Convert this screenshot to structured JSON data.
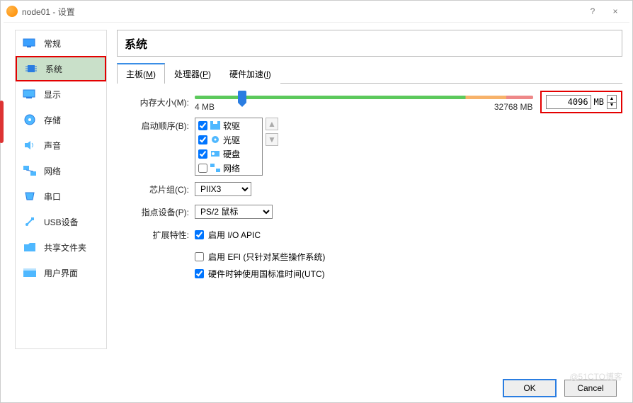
{
  "window": {
    "title": "node01 - 设置",
    "help": "?",
    "close": "×"
  },
  "sidebar": {
    "items": [
      {
        "label": "常规"
      },
      {
        "label": "系统"
      },
      {
        "label": "显示"
      },
      {
        "label": "存储"
      },
      {
        "label": "声音"
      },
      {
        "label": "网络"
      },
      {
        "label": "串口"
      },
      {
        "label": "USB设备"
      },
      {
        "label": "共享文件夹"
      },
      {
        "label": "用户界面"
      }
    ]
  },
  "panel": {
    "title": "系统",
    "tabs": [
      {
        "label": "主板",
        "key": "M"
      },
      {
        "label": "处理器",
        "key": "P"
      },
      {
        "label": "硬件加速",
        "key": "l"
      }
    ],
    "memory": {
      "label": "内存大小(M):",
      "min_label": "4 MB",
      "max_label": "32768 MB",
      "value": "4096",
      "unit": "MB",
      "thumb_pct": 14
    },
    "boot": {
      "label": "启动顺序(B):",
      "items": [
        {
          "label": "软驱",
          "checked": true,
          "icon": "floppy"
        },
        {
          "label": "光驱",
          "checked": true,
          "icon": "cd"
        },
        {
          "label": "硬盘",
          "checked": true,
          "icon": "hdd"
        },
        {
          "label": "网络",
          "checked": false,
          "icon": "net"
        }
      ]
    },
    "chipset": {
      "label": "芯片组(C):",
      "value": "PIIX3"
    },
    "pointing": {
      "label": "指点设备(P):",
      "value": "PS/2 鼠标"
    },
    "ext": {
      "label": "扩展特性:",
      "items": [
        {
          "label": "启用 I/O APIC",
          "checked": true
        },
        {
          "label": "启用 EFI (只针对某些操作系统)",
          "checked": false
        },
        {
          "label": "硬件时钟使用国标准时间(UTC)",
          "checked": true
        }
      ]
    }
  },
  "footer": {
    "ok": "OK",
    "cancel": "Cancel"
  },
  "watermark": "@51CTO博客"
}
